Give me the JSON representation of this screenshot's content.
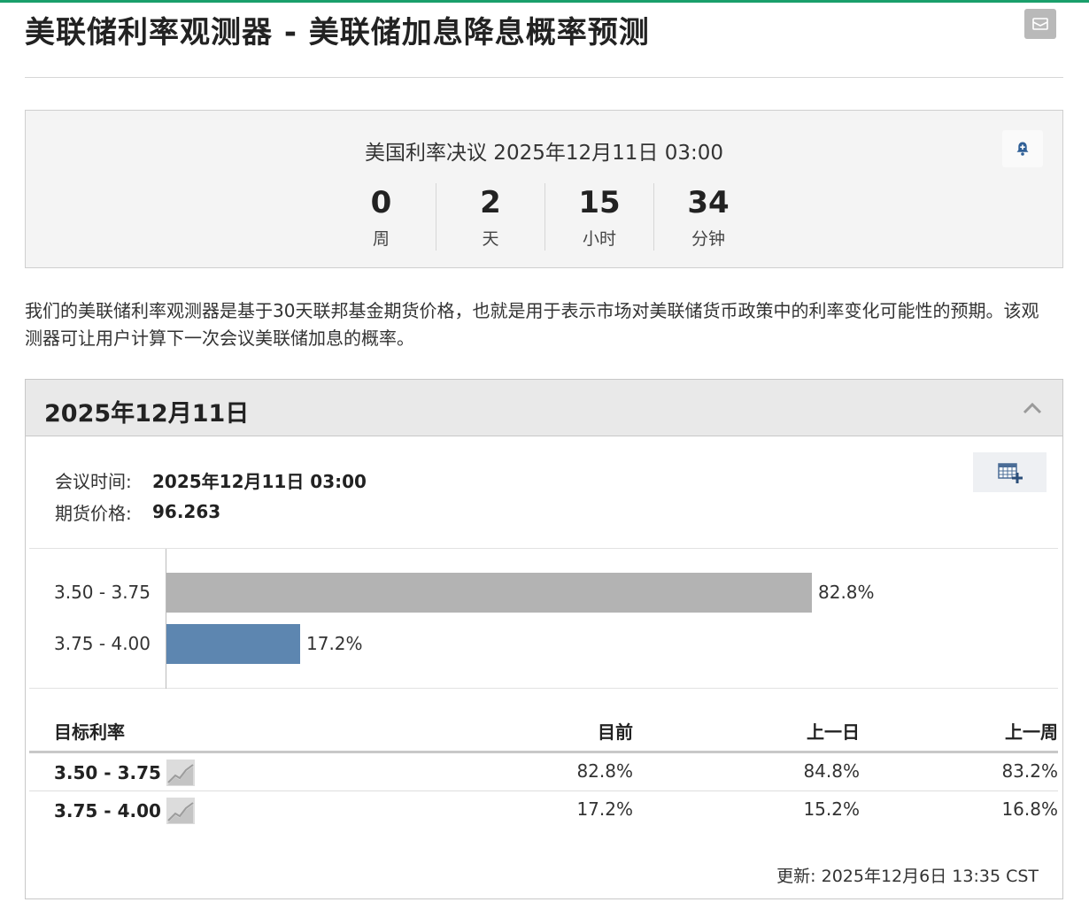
{
  "page": {
    "title": "美联储利率观测器 - 美联储加息降息概率预测"
  },
  "countdown": {
    "event_title": "美国利率决议 2025年12月11日 03:00",
    "units": [
      {
        "value": "0",
        "label": "周"
      },
      {
        "value": "2",
        "label": "天"
      },
      {
        "value": "15",
        "label": "小时"
      },
      {
        "value": "34",
        "label": "分钟"
      }
    ]
  },
  "description": "我们的美联储利率观测器是基于30天联邦基金期货价格，也就是用于表示市场对美联储货币政策中的利率变化可能性的预期。该观测器可让用户计算下一次会议美联储加息的概率。",
  "meeting": {
    "date_header": "2025年12月11日",
    "time_label": "会议时间:",
    "time_value": "2025年12月11日 03:00",
    "price_label": "期货价格:",
    "price_value": "96.263"
  },
  "chart_data": {
    "type": "bar",
    "orientation": "horizontal",
    "categories": [
      "3.50 - 3.75",
      "3.75 - 4.00"
    ],
    "values": [
      82.8,
      17.2
    ],
    "value_labels": [
      "82.8%",
      "17.2%"
    ],
    "colors": [
      "#b3b3b3",
      "#5d86b0"
    ],
    "xlim": [
      0,
      100
    ]
  },
  "table": {
    "headers": {
      "rate": "目标利率",
      "current": "目前",
      "prev_day": "上一日",
      "prev_week": "上一周"
    },
    "rows": [
      {
        "rate": "3.50 - 3.75",
        "current": "82.8%",
        "prev_day": "84.8%",
        "prev_week": "83.2%"
      },
      {
        "rate": "3.75 - 4.00",
        "current": "17.2%",
        "prev_day": "15.2%",
        "prev_week": "16.8%"
      }
    ]
  },
  "updated": "更新: 2025年12月6日 13:35 CST",
  "icons": {
    "mail": "mail-icon",
    "bell": "bell-add-icon",
    "collapse": "chevron-up-icon",
    "calendar": "calendar-add-icon",
    "sparkline": "sparkline-icon"
  }
}
